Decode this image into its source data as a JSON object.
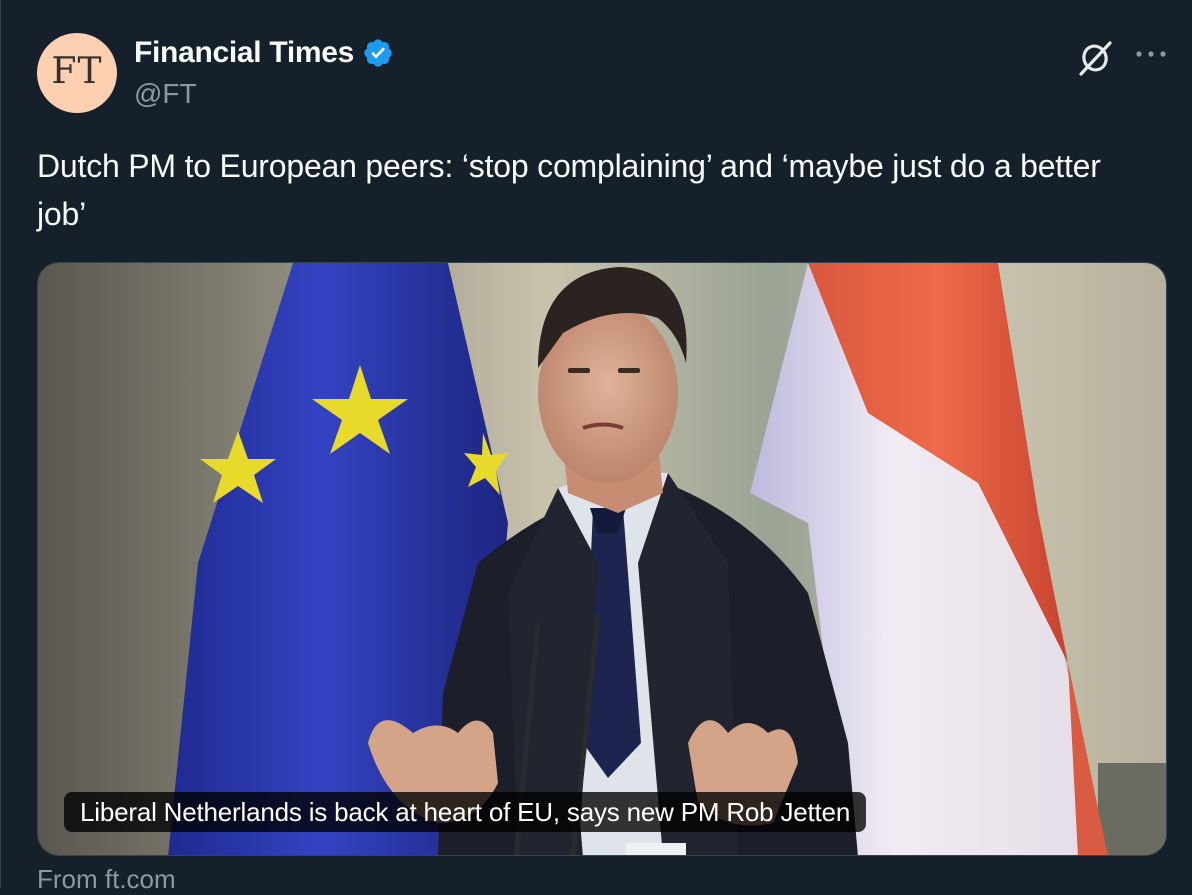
{
  "author": {
    "avatar_text": "FT",
    "name": "Financial Times",
    "handle": "@FT",
    "verified_icon": "verified-badge-icon"
  },
  "actions": {
    "grok_icon": "grok-icon",
    "more_icon": "more-horizontal-icon"
  },
  "tweet": {
    "text": "Dutch PM to European peers: ‘stop complaining’ and ‘maybe just do a better job’"
  },
  "card": {
    "caption": "Liberal Netherlands is back at heart of EU, says new PM Rob Jetten",
    "source": "From ft.com"
  },
  "colors": {
    "background": "#15202b",
    "text": "#f7f9f9",
    "secondary": "#8b98a5",
    "verified": "#1d9bf0",
    "avatar_bg": "#fcd0b1"
  }
}
